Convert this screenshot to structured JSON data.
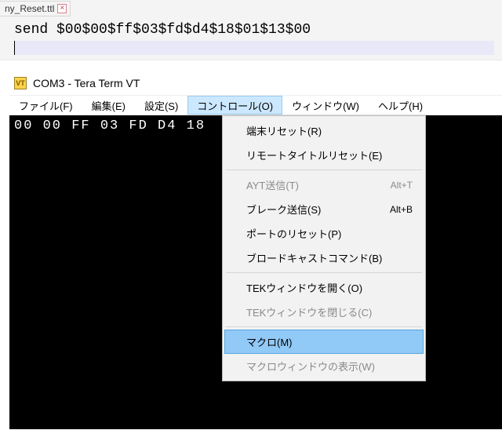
{
  "editor": {
    "tab_name": "ny_Reset.ttl",
    "line": "send $00$00$ff$03$fd$d4$18$01$13$00"
  },
  "teraterm": {
    "title": "COM3 - Tera Term VT",
    "menubar": {
      "file": "ファイル(F)",
      "edit": "編集(E)",
      "setup": "設定(S)",
      "control": "コントロール(O)",
      "window": "ウィンドウ(W)",
      "help": "ヘルプ(H)"
    },
    "terminal_line": "00 00 FF 03 FD D4 18"
  },
  "dropdown": {
    "reset_terminal": "端末リセット(R)",
    "reset_remote_title": "リモートタイトルリセット(E)",
    "ayt_send": "AYT送信(T)",
    "ayt_shortcut": "Alt+T",
    "break_send": "ブレーク送信(S)",
    "break_shortcut": "Alt+B",
    "reset_port": "ポートのリセット(P)",
    "broadcast": "ブロードキャストコマンド(B)",
    "tek_open": "TEKウィンドウを開く(O)",
    "tek_close": "TEKウィンドウを閉じる(C)",
    "macro": "マクロ(M)",
    "macro_window": "マクロウィンドウの表示(W)"
  }
}
